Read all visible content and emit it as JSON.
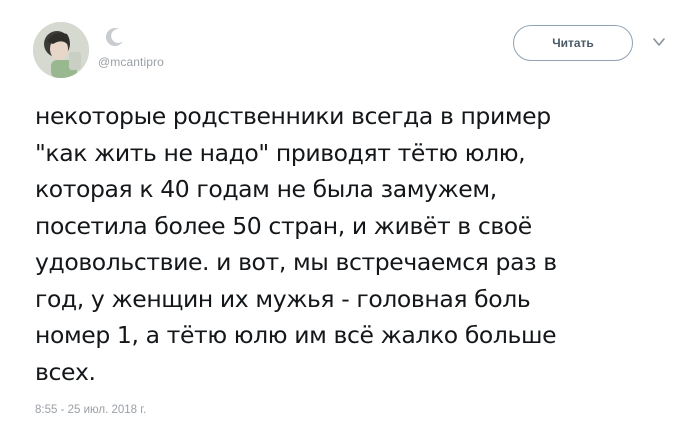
{
  "tweet": {
    "handle": "@mcantipro",
    "follow_label": "Читать",
    "icons": {
      "avatar": "avatar-photo",
      "crescent": "crescent-moon-icon",
      "caret": "chevron-down-icon"
    },
    "text_lines": [
      "некоторые родственники всегда в пример",
      "\"как жить не надо\" приводят тётю юлю,",
      "которая к 40 годам не была замужем,",
      "посетила более 50 стран, и живёт в своё",
      "удовольствие. и вот, мы встречаемся раз в",
      "год, у женщин их мужья - головная боль",
      "номер 1, а тётю юлю им всё жалко больше",
      "всех."
    ],
    "timestamp": "8:55 - 25 июл. 2018 г."
  },
  "colors": {
    "text": "#14171a",
    "muted": "#9aa0a6",
    "button_border": "#8fa3b4"
  }
}
